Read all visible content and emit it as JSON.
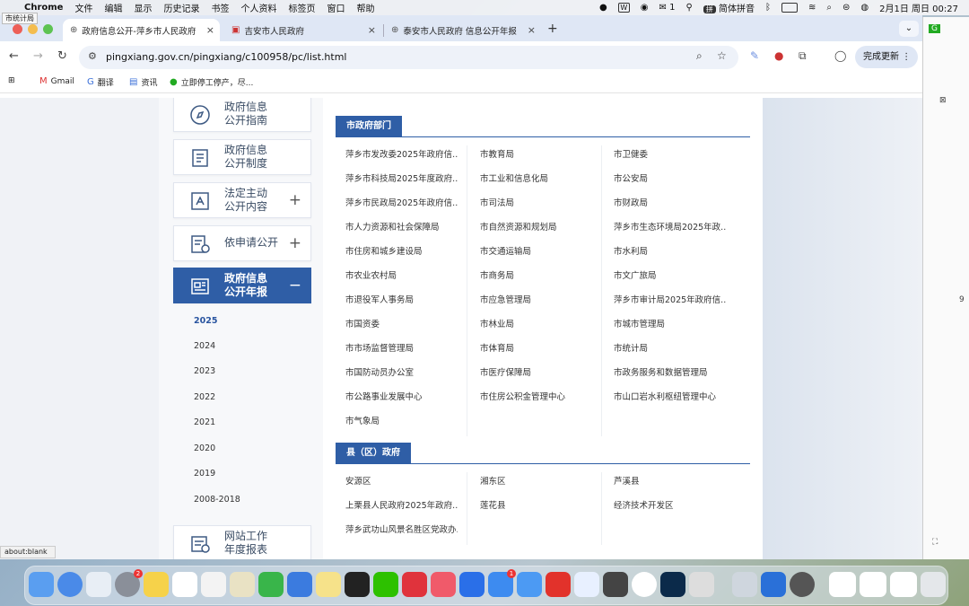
{
  "menubar": {
    "tooltip": "市统计局",
    "items": [
      "Chrome",
      "文件",
      "编辑",
      "显示",
      "历史记录",
      "书签",
      "个人资料",
      "标签页",
      "窗口",
      "帮助"
    ],
    "wechat_count": "1",
    "input_method": "简体拼音",
    "datetime": "2月1日 周日  00:27"
  },
  "tabs": [
    {
      "title": "政府信息公开-萍乡市人民政府"
    },
    {
      "title": "吉安市人民政府"
    },
    {
      "title": "泰安市人民政府 信息公开年报"
    }
  ],
  "toolbar": {
    "url": "pingxiang.gov.cn/pingxiang/c100958/pc/list.html",
    "update_label": "完成更新"
  },
  "bookmarks": [
    {
      "label": "Gmail"
    },
    {
      "label": "翻译"
    },
    {
      "label": "资讯"
    },
    {
      "label": "立即停工停产，尽..."
    }
  ],
  "sidebar": {
    "buttons": [
      {
        "line1": "政府信息",
        "line2": "公开指南",
        "toggle": "",
        "icon": "compass-icon"
      },
      {
        "line1": "政府信息",
        "line2": "公开制度",
        "toggle": "",
        "icon": "document-icon"
      },
      {
        "line1": "法定主动",
        "line2": "公开内容",
        "toggle": "+",
        "icon": "stamp-icon"
      },
      {
        "line1": "依申请公开",
        "line2": "",
        "toggle": "+",
        "icon": "application-icon"
      },
      {
        "line1": "政府信息",
        "line2": "公开年报",
        "toggle": "−",
        "icon": "report-icon"
      }
    ],
    "years": [
      "2025",
      "2024",
      "2023",
      "2022",
      "2021",
      "2020",
      "2019",
      "2008-2018"
    ],
    "bottom": {
      "line1": "网站工作",
      "line2": "年度报表"
    }
  },
  "main": {
    "sections": [
      {
        "title": "市政府部门",
        "items": [
          "萍乡市发改委2025年政府信...",
          "市教育局",
          "市卫健委",
          "萍乡市科技局2025年度政府...",
          "市工业和信息化局",
          "市公安局",
          "萍乡市民政局2025年政府信...",
          "市司法局",
          "市财政局",
          "市人力资源和社会保障局",
          "市自然资源和规划局",
          "萍乡市生态环境局2025年政...",
          "市住房和城乡建设局",
          "市交通运输局",
          "市水利局",
          "市农业农村局",
          "市商务局",
          "市文广旅局",
          "市退役军人事务局",
          "市应急管理局",
          "萍乡市审计局2025年政府信...",
          "市国资委",
          "市林业局",
          "市城市管理局",
          "市市场监督管理局",
          "市体育局",
          "市统计局",
          "市国防动员办公室",
          "市医疗保障局",
          "市政务服务和数据管理局",
          "市公路事业发展中心",
          "市住房公积金管理中心",
          "市山口岩水利枢纽管理中心",
          "市气象局"
        ]
      },
      {
        "title": "县（区）政府",
        "items": [
          "安源区",
          "湘东区",
          "芦溪县",
          "上栗县人民政府2025年政府...",
          "莲花县",
          "经济技术开发区",
          "萍乡武功山风景名胜区党政办..."
        ]
      }
    ]
  },
  "statusbar": "about:blank",
  "colors": {
    "accent": "#2f5ea6",
    "tab_strip": "#dfe7f5"
  }
}
